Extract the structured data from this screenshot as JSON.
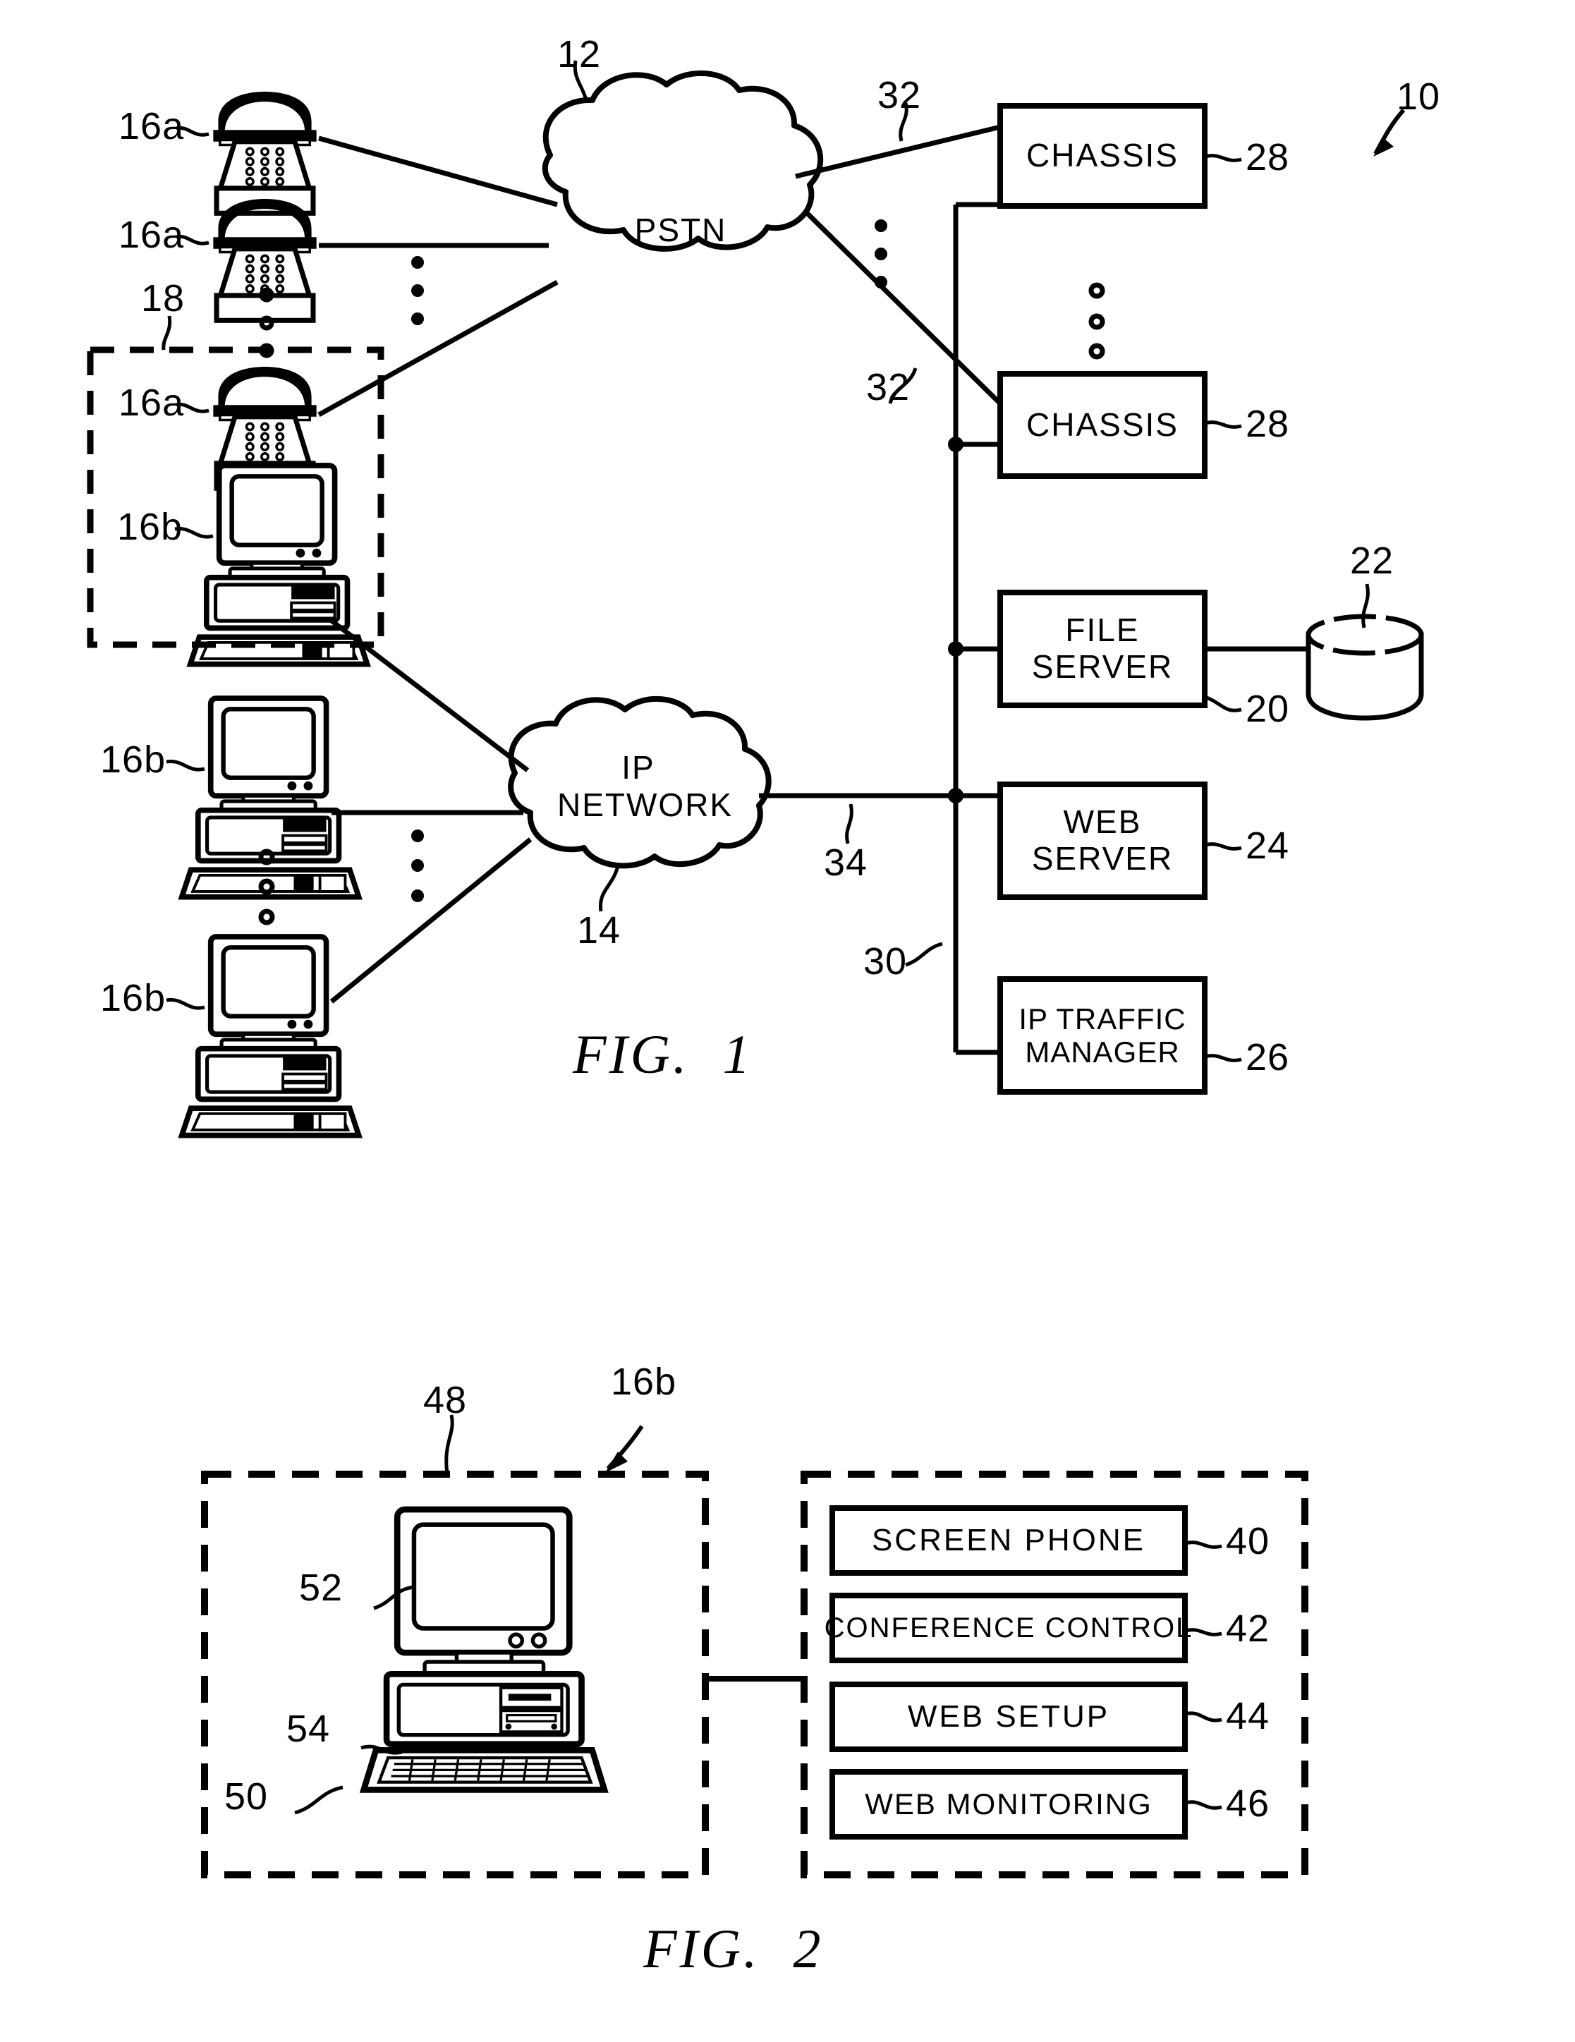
{
  "figures": [
    {
      "id": "fig1",
      "caption": "FIG.  1",
      "system_ref": "10",
      "networks": [
        {
          "name": "PSTN",
          "ref": "12"
        },
        {
          "name": "IP\nNETWORK",
          "ref": "14"
        }
      ],
      "endpoints": [
        {
          "ref": "16a",
          "type": "telephone"
        },
        {
          "ref": "16a",
          "type": "telephone"
        },
        {
          "ref": "16a",
          "type": "telephone"
        },
        {
          "ref": "16b",
          "type": "computer"
        },
        {
          "ref": "16b",
          "type": "computer"
        },
        {
          "ref": "16b",
          "type": "computer"
        }
      ],
      "group_box_ref": "18",
      "server_blocks": [
        {
          "label": "CHASSIS",
          "ref": "28"
        },
        {
          "label": "CHASSIS",
          "ref": "28"
        },
        {
          "label": "FILE\nSERVER",
          "ref": "20"
        },
        {
          "label": "WEB\nSERVER",
          "ref": "24"
        },
        {
          "label": "IP TRAFFIC\nMANAGER",
          "ref": "26"
        }
      ],
      "database": {
        "ref": "22"
      },
      "links": [
        {
          "ref": "32",
          "desc": "pstn-to-chassis-upper"
        },
        {
          "ref": "32",
          "desc": "pstn-to-chassis-lower"
        },
        {
          "ref": "34",
          "desc": "ip-network-to-bus"
        },
        {
          "ref": "30",
          "desc": "server-bus"
        }
      ]
    },
    {
      "id": "fig2",
      "caption": "FIG.  2",
      "device_ref": "16b",
      "hardware_box_ref": "48",
      "hardware_parts": [
        {
          "label": "",
          "ref": "52",
          "desc": "monitor"
        },
        {
          "label": "",
          "ref": "54",
          "desc": "system-unit"
        },
        {
          "label": "",
          "ref": "50",
          "desc": "keyboard"
        }
      ],
      "application_modules": [
        {
          "label": "SCREEN PHONE",
          "ref": "40"
        },
        {
          "label": "CONFERENCE CONTROL",
          "ref": "42"
        },
        {
          "label": "WEB SETUP",
          "ref": "44"
        },
        {
          "label": "WEB MONITORING",
          "ref": "46"
        }
      ]
    }
  ],
  "colors": {
    "line": "#000000",
    "background": "#ffffff"
  }
}
